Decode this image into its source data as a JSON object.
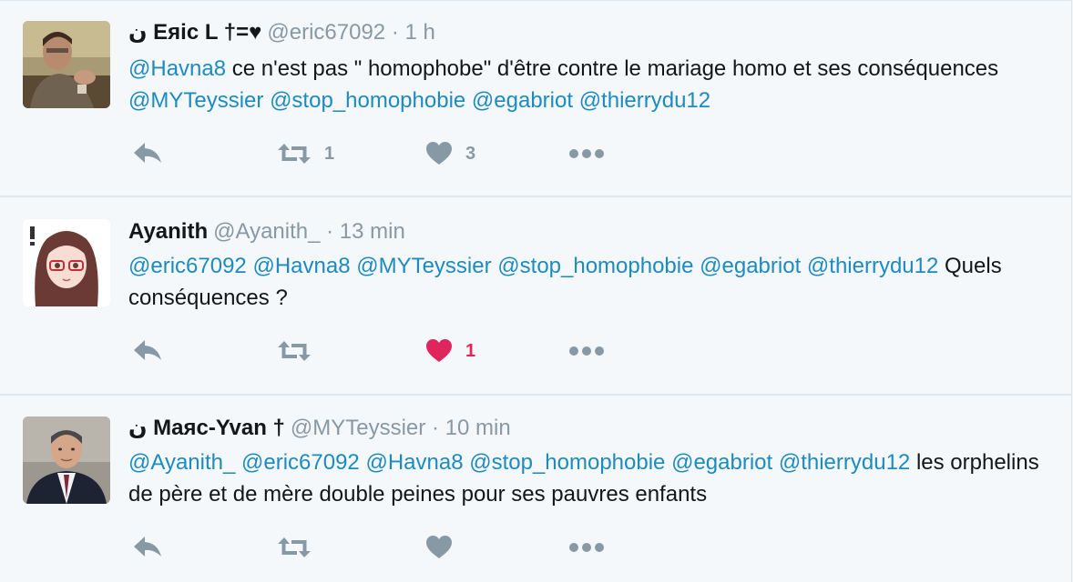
{
  "colors": {
    "background": "#f5f8fa",
    "text": "#14171a",
    "muted": "#8899a6",
    "link": "#1c8bc2",
    "like_active": "#e0245e",
    "border": "#e1e8ed"
  },
  "tweets": [
    {
      "name": "ن Eяic L †=♥",
      "handle": "@eric67092",
      "separator": "·",
      "time": "1 h",
      "text_parts": [
        {
          "t": "@Havna8",
          "mention": true
        },
        {
          "t": " ce n'est pas \" homophobe\" d'être contre le mariage homo et ses conséquences  ",
          "mention": false
        },
        {
          "t": "@MYTeyssier",
          "mention": true
        },
        {
          "t": " ",
          "mention": false
        },
        {
          "t": "@stop_homophobie",
          "mention": true
        },
        {
          "t": " ",
          "mention": false
        },
        {
          "t": "@egabriot",
          "mention": true
        },
        {
          "t": " ",
          "mention": false
        },
        {
          "t": "@thierrydu12",
          "mention": true
        }
      ],
      "retweet_count": "1",
      "like_count": "3",
      "liked": false,
      "avatar": "avatar-eric"
    },
    {
      "name": "Ayanith",
      "handle": "@Ayanith_",
      "separator": "·",
      "time": "13 min",
      "text_parts": [
        {
          "t": "@eric67092",
          "mention": true
        },
        {
          "t": " ",
          "mention": false
        },
        {
          "t": "@Havna8",
          "mention": true
        },
        {
          "t": " ",
          "mention": false
        },
        {
          "t": "@MYTeyssier",
          "mention": true
        },
        {
          "t": " ",
          "mention": false
        },
        {
          "t": "@stop_homophobie",
          "mention": true
        },
        {
          "t": " ",
          "mention": false
        },
        {
          "t": "@egabriot",
          "mention": true
        },
        {
          "t": " ",
          "mention": false
        },
        {
          "t": "@thierrydu12",
          "mention": true
        },
        {
          "t": " Quels conséquences ?",
          "mention": false
        }
      ],
      "retweet_count": "",
      "like_count": "1",
      "liked": true,
      "avatar": "avatar-ayanith"
    },
    {
      "name": "ن Maяc-Yvan †",
      "handle": "@MYTeyssier",
      "separator": "·",
      "time": "10 min",
      "text_parts": [
        {
          "t": "@Ayanith_",
          "mention": true
        },
        {
          "t": "  ",
          "mention": false
        },
        {
          "t": "@eric67092",
          "mention": true
        },
        {
          "t": " ",
          "mention": false
        },
        {
          "t": "@Havna8",
          "mention": true
        },
        {
          "t": " ",
          "mention": false
        },
        {
          "t": "@stop_homophobie",
          "mention": true
        },
        {
          "t": " ",
          "mention": false
        },
        {
          "t": "@egabriot",
          "mention": true
        },
        {
          "t": " ",
          "mention": false
        },
        {
          "t": "@thierrydu12",
          "mention": true
        },
        {
          "t": " les orphelins de père et de mère double peines pour ses pauvres enfants",
          "mention": false
        }
      ],
      "retweet_count": "",
      "like_count": "",
      "liked": false,
      "avatar": "avatar-marc"
    }
  ],
  "icons": {
    "reply": "reply-icon",
    "retweet": "retweet-icon",
    "like": "heart-icon",
    "more": "more-icon"
  }
}
